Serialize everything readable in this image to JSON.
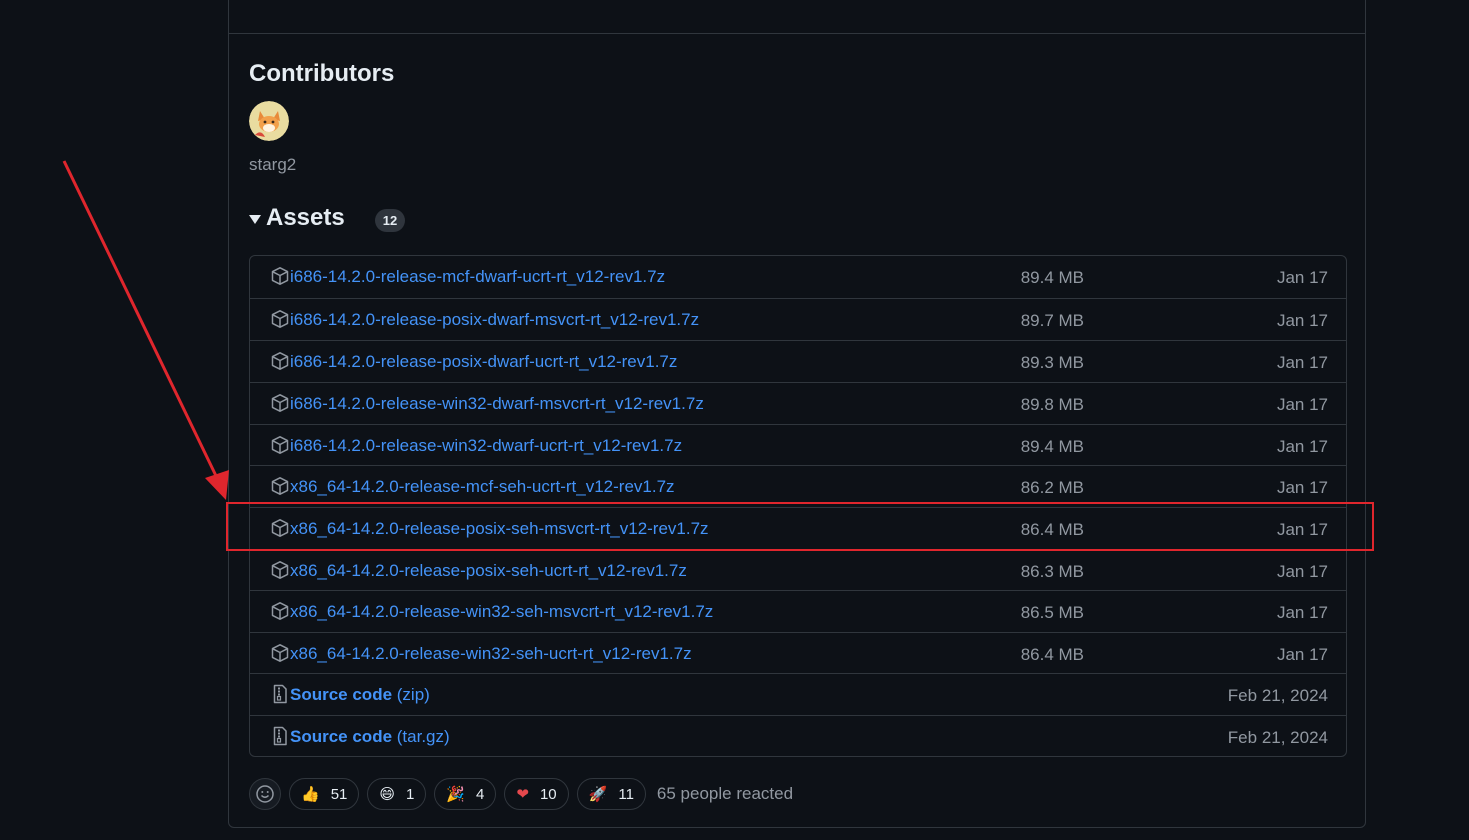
{
  "contributors": {
    "title": "Contributors",
    "users": [
      {
        "name": "starg2"
      }
    ]
  },
  "assets": {
    "title": "Assets",
    "count": "12",
    "items": [
      {
        "name": "i686-14.2.0-release-mcf-dwarf-ucrt-rt_v12-rev1.7z",
        "size": "89.4 MB",
        "date": "Jan 17",
        "icon": "package-icon"
      },
      {
        "name": "i686-14.2.0-release-posix-dwarf-msvcrt-rt_v12-rev1.7z",
        "size": "89.7 MB",
        "date": "Jan 17",
        "icon": "package-icon"
      },
      {
        "name": "i686-14.2.0-release-posix-dwarf-ucrt-rt_v12-rev1.7z",
        "size": "89.3 MB",
        "date": "Jan 17",
        "icon": "package-icon"
      },
      {
        "name": "i686-14.2.0-release-win32-dwarf-msvcrt-rt_v12-rev1.7z",
        "size": "89.8 MB",
        "date": "Jan 17",
        "icon": "package-icon"
      },
      {
        "name": "i686-14.2.0-release-win32-dwarf-ucrt-rt_v12-rev1.7z",
        "size": "89.4 MB",
        "date": "Jan 17",
        "icon": "package-icon"
      },
      {
        "name": "x86_64-14.2.0-release-mcf-seh-ucrt-rt_v12-rev1.7z",
        "size": "86.2 MB",
        "date": "Jan 17",
        "icon": "package-icon"
      },
      {
        "name": "x86_64-14.2.0-release-posix-seh-msvcrt-rt_v12-rev1.7z",
        "size": "86.4 MB",
        "date": "Jan 17",
        "icon": "package-icon",
        "highlighted": true
      },
      {
        "name": "x86_64-14.2.0-release-posix-seh-ucrt-rt_v12-rev1.7z",
        "size": "86.3 MB",
        "date": "Jan 17",
        "icon": "package-icon"
      },
      {
        "name": "x86_64-14.2.0-release-win32-seh-msvcrt-rt_v12-rev1.7z",
        "size": "86.5 MB",
        "date": "Jan 17",
        "icon": "package-icon"
      },
      {
        "name": "x86_64-14.2.0-release-win32-seh-ucrt-rt_v12-rev1.7z",
        "size": "86.4 MB",
        "date": "Jan 17",
        "icon": "package-icon"
      }
    ],
    "source": [
      {
        "label": "Source code",
        "format": "(zip)",
        "date": "Feb 21, 2024",
        "icon": "file-zip-icon"
      },
      {
        "label": "Source code",
        "format": "(tar.gz)",
        "date": "Feb 21, 2024",
        "icon": "file-zip-icon"
      }
    ]
  },
  "reactions": {
    "items": [
      {
        "emoji": "👍",
        "icon": "thumbs-up-icon",
        "count": "51"
      },
      {
        "emoji": "😄",
        "icon": "laugh-icon",
        "count": "1"
      },
      {
        "emoji": "🎉",
        "icon": "hooray-icon",
        "count": "4"
      },
      {
        "emoji": "❤",
        "icon": "heart-icon",
        "count": "10"
      },
      {
        "emoji": "🚀",
        "icon": "rocket-icon",
        "count": "11"
      }
    ],
    "summary": "65 people reacted"
  },
  "colors": {
    "background": "#0d1117",
    "border": "#30363d",
    "link": "#4493f8",
    "muted_text": "#9198a1",
    "annotation_red": "#e0262d"
  }
}
